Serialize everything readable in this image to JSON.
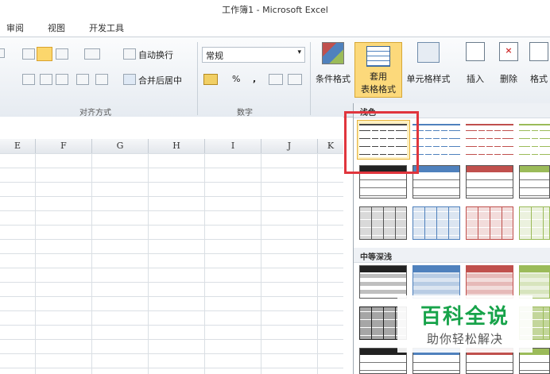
{
  "window": {
    "title": "工作簿1 - Microsoft Excel"
  },
  "tabs": [
    "审阅",
    "视图",
    "开发工具"
  ],
  "ribbon": {
    "alignment": {
      "label": "对齐方式",
      "wrap_text": "自动换行",
      "merge_center": "合并后居中"
    },
    "number": {
      "label": "数字",
      "format": "常规",
      "percent": "%",
      "comma": ","
    },
    "styles": {
      "conditional": "条件格式",
      "table_format_line1": "套用",
      "table_format_line2": "表格格式",
      "cell_styles": "单元格样式"
    },
    "cells": {
      "insert": "插入",
      "delete": "删除",
      "format": "格式"
    }
  },
  "columns": [
    "E",
    "F",
    "G",
    "H",
    "I",
    "J",
    "K"
  ],
  "gallery": {
    "section_light": "浅色",
    "section_medium": "中等深浅",
    "colors": {
      "blue": "#4f81bd",
      "red": "#c0504d",
      "green": "#9bbb59",
      "dark": "#222222",
      "gray": "#888888"
    }
  },
  "watermark": {
    "line1": "百科全说",
    "line2": "助你轻松解决"
  }
}
